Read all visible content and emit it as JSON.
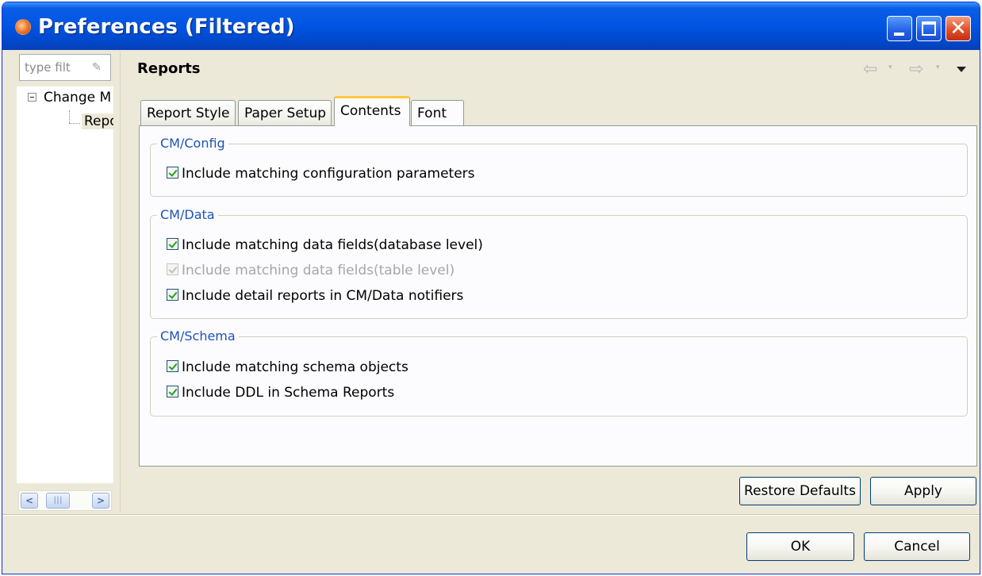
{
  "window": {
    "title": "Preferences (Filtered)"
  },
  "titlebar": {
    "minimize": "minimize-icon",
    "maximize": "maximize-icon",
    "close_glyph": "✕"
  },
  "sidebar": {
    "filter_placeholder": "type filter text",
    "filter_value": "type filt",
    "tree": [
      {
        "label": "Change M",
        "expanded": true
      },
      {
        "label": "Repor",
        "selected": true
      }
    ],
    "scroll_left": "<",
    "scroll_thumb": "|||",
    "scroll_right": ">"
  },
  "page": {
    "title": "Reports",
    "nav_back": "⇦",
    "nav_back_dropdown": "▾",
    "nav_forward": "⇨",
    "nav_forward_dropdown": "▾"
  },
  "tabs": [
    {
      "label": "Report Style"
    },
    {
      "label": "Paper Setup"
    },
    {
      "label": "Contents",
      "active": true
    },
    {
      "label": "Font"
    }
  ],
  "groups": {
    "config": {
      "title": "CM/Config",
      "items": [
        {
          "label": "Include matching configuration parameters",
          "checked": true,
          "enabled": true
        }
      ]
    },
    "data": {
      "title": "CM/Data",
      "items": [
        {
          "label": "Include matching data fields(database level)",
          "checked": true,
          "enabled": true
        },
        {
          "label": "Include matching data fields(table level)",
          "checked": true,
          "enabled": false
        },
        {
          "label": "Include detail reports in CM/Data notifiers",
          "checked": true,
          "enabled": true
        }
      ]
    },
    "schema": {
      "title": "CM/Schema",
      "items": [
        {
          "label": "Include matching schema objects",
          "checked": true,
          "enabled": true
        },
        {
          "label": "Include DDL in Schema Reports",
          "checked": true,
          "enabled": true
        }
      ]
    }
  },
  "buttons": {
    "restore_defaults": "Restore Defaults",
    "apply": "Apply",
    "ok": "OK",
    "cancel": "Cancel"
  },
  "colors": {
    "titlebar": "#0054e3",
    "group_label": "#1f52b8",
    "check_mark": "#21a121",
    "active_tab_highlight": "#ffc83c",
    "dialog_bg": "#ece9d8"
  }
}
